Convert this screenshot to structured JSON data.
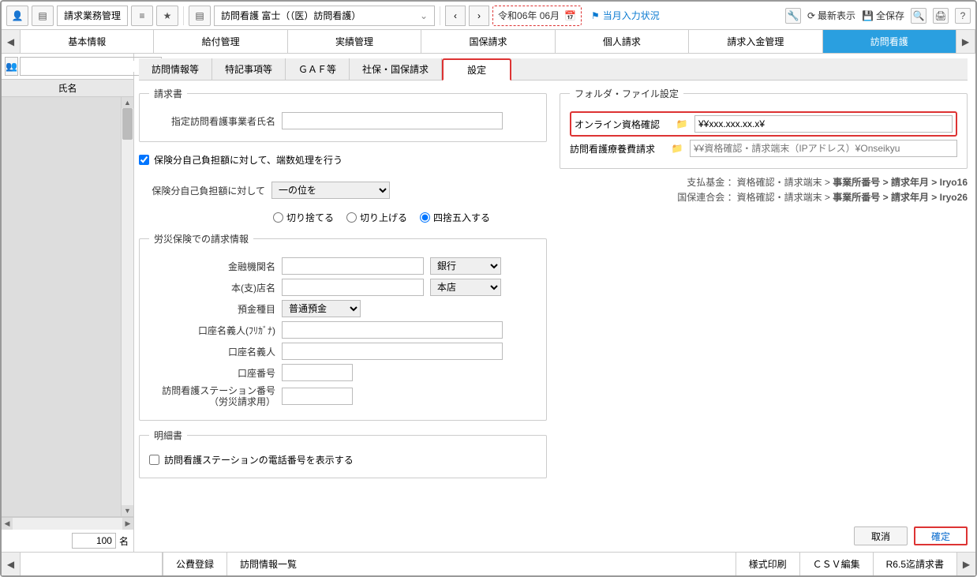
{
  "toolbar": {
    "title": "請求業務管理",
    "context": "訪問看護 富士（（医）訪問看護）",
    "date": "令和06年 06月",
    "flag_link": "当月入力状況",
    "refresh": "最新表示",
    "save_all": "全保存"
  },
  "main_tabs": [
    "基本情報",
    "給付管理",
    "実績管理",
    "国保請求",
    "個人請求",
    "請求入金管理",
    "訪問看護"
  ],
  "main_tab_active": 6,
  "sidebar": {
    "header": "氏名",
    "count_value": "100",
    "count_suffix": "名"
  },
  "sub_tabs": [
    "訪問情報等",
    "特記事項等",
    "ＧＡＦ等",
    "社保・国保請求",
    "設定"
  ],
  "sub_tab_active": 4,
  "seikyu": {
    "legend": "請求書",
    "provider_label": "指定訪問看護事業者氏名",
    "provider_value": "",
    "round_check_label": "保険分自己負担額に対して、端数処理を行う",
    "round_check": true,
    "round_select_label": "保険分自己負担額に対して",
    "round_select_value": "一の位を",
    "radios": [
      "切り捨てる",
      "切り上げる",
      "四捨五入する"
    ],
    "radio_selected": 2
  },
  "rousai": {
    "legend": "労災保険での請求情報",
    "bank_label": "金融機関名",
    "bank_value": "",
    "bank_type": "銀行",
    "branch_label": "本(支)店名",
    "branch_value": "",
    "branch_type": "本店",
    "acct_type_label": "預金種目",
    "acct_type_value": "普通預金",
    "kana_label": "口座名義人(ﾌﾘｶﾞﾅ)",
    "kana_value": "",
    "holder_label": "口座名義人",
    "holder_value": "",
    "acct_no_label": "口座番号",
    "acct_no_value": "",
    "station_label1": "訪問看護ステーション番号",
    "station_label2": "（労災請求用）",
    "station_value": ""
  },
  "meisai": {
    "legend": "明細書",
    "phone_check_label": "訪問看護ステーションの電話番号を表示する",
    "phone_check": false
  },
  "folder": {
    "legend": "フォルダ・ファイル設定",
    "rows": [
      {
        "label": "オンライン資格確認",
        "value": "¥¥xxx.xxx.xx.x¥",
        "highlight": true,
        "placeholder": ""
      },
      {
        "label": "訪問看護療養費請求",
        "value": "",
        "highlight": false,
        "placeholder": "¥¥資格確認・請求端末（IPアドレス）¥Onseikyu"
      }
    ],
    "notes": [
      {
        "org": "支払基金",
        "sep": "：",
        "pre": "資格確認・請求端末 > ",
        "bold": "事業所番号 > 請求年月 > Iryo16"
      },
      {
        "org": "国保連合会",
        "sep": "：",
        "pre": "資格確認・請求端末 > ",
        "bold": "事業所番号 > 請求年月 > Iryo26"
      }
    ]
  },
  "buttons": {
    "cancel": "取消",
    "confirm": "確定"
  },
  "footer": [
    "公費登録",
    "訪問情報一覧",
    "様式印刷",
    "ＣＳＶ編集",
    "R6.5迄請求書"
  ]
}
